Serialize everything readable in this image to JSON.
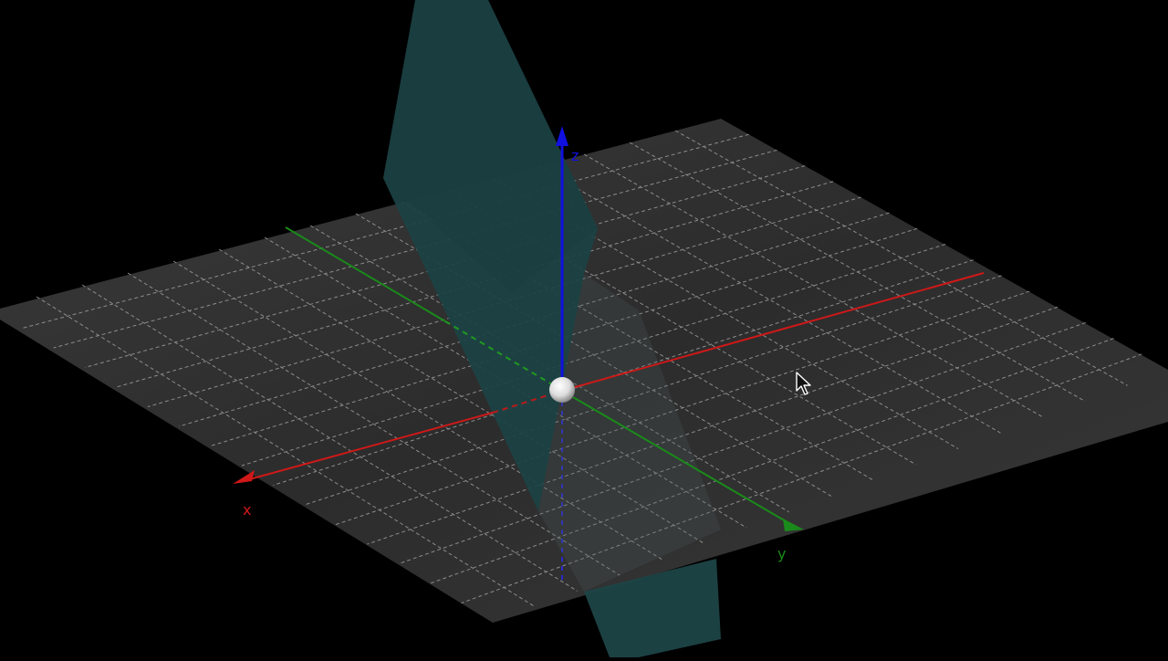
{
  "axes": {
    "x": {
      "label": "x",
      "color": "#d01818"
    },
    "y": {
      "label": "y",
      "color": "#1a8a1a"
    },
    "z": {
      "label": "z",
      "color": "#1010e0"
    }
  },
  "colors": {
    "background": "#000000",
    "ground_plane": "#2d2d2d",
    "grid_lines": "#9a9a9a",
    "vertical_plane": "#1d4244",
    "origin_point": "#e8e8e8"
  },
  "objects": {
    "ground_plane": "xy-plane",
    "vertical_plane": "plane",
    "origin_point": "point"
  },
  "cursor": "arrow-cursor-icon"
}
